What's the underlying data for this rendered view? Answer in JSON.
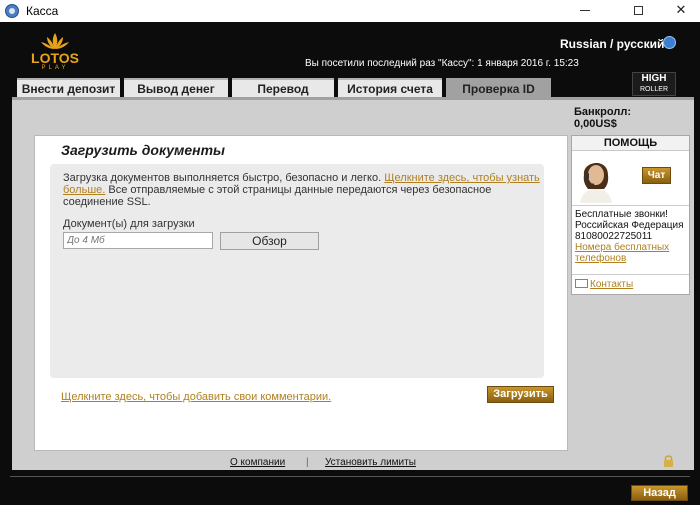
{
  "window": {
    "title": "Касса"
  },
  "header": {
    "brand_name": "LOTOS",
    "brand_sub": "PLAY",
    "language": "Russian / русский",
    "last_visit": "Вы посетили последний раз \"Кассу\": 1 января 2016 г. 15:23",
    "high_roller_line1": "HIGH",
    "high_roller_line2": "ROLLER"
  },
  "tabs": [
    {
      "label": "Внести депозит",
      "active": false
    },
    {
      "label": "Вывод денег",
      "active": false
    },
    {
      "label": "Перевод",
      "active": false
    },
    {
      "label": "История счета",
      "active": false
    },
    {
      "label": "Проверка ID",
      "active": true
    }
  ],
  "main": {
    "heading": "Загрузить документы",
    "info_text": "Загрузка документов выполняется быстро, безопасно и легко.",
    "info_link": "Щелкните здесь, чтобы узнать больше.",
    "info_text2": "Все отправляемые с этой страницы данные передаются через безопасное соединение SSL.",
    "upload_label": "Документ(ы) для загрузки",
    "file_placeholder": "До 4 Мб",
    "browse_label": "Обзор",
    "comment_link": "Щелкните здесь, чтобы добавить свои комментарии.",
    "upload_button": "Загрузить"
  },
  "sidebar": {
    "bankroll_label": "Банкролл:",
    "bankroll_value": "0,00US$",
    "help_title": "ПОМОЩЬ",
    "chat_label": "Чат",
    "free_calls_label": "Бесплатные звонки!",
    "country": "Российская Федерация",
    "phone": "81080022725011",
    "free_numbers_link": "Номера бесплатных телефонов",
    "contacts_link": "Контакты"
  },
  "footer": {
    "about_link": "О компании",
    "separator": "|",
    "limits_link": "Установить лимиты",
    "back_button": "Назад"
  },
  "colors": {
    "accent": "#b08020",
    "button_gold": "#a87520",
    "panel_bg": "#cfcfcf",
    "tab_active": "#a1a1a1",
    "window_bg": "#0c0c0c"
  }
}
